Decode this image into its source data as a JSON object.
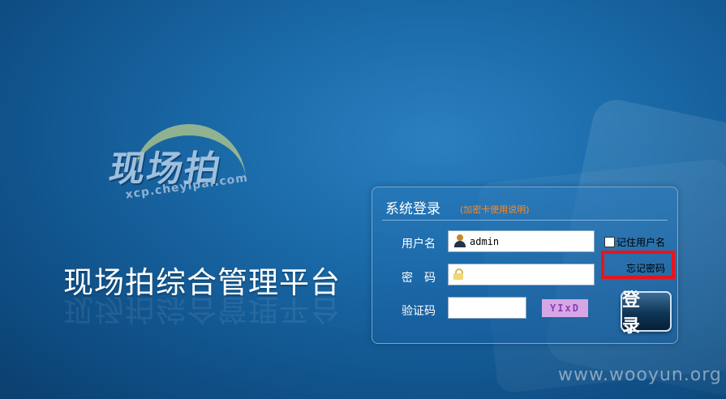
{
  "logo": {
    "brand_cn": "现场拍",
    "url": "xcp.cheyipai.com"
  },
  "platform_title": "现场拍综合管理平台",
  "login_panel": {
    "title": "系统登录",
    "help_link": "(加密卡使用说明)",
    "username_label": "用户名",
    "username_value": "admin",
    "password_label": "密　码",
    "password_value": "",
    "captcha_label": "验证码",
    "captcha_value": "",
    "captcha_image_text": "YIxD",
    "remember_label": "记住用户名",
    "forgot_link": "忘记密码",
    "login_button": "登 录"
  },
  "watermark": "www.wooyun.org",
  "colors": {
    "highlight_box": "#e8141b",
    "help_link": "#ff8a1e",
    "captcha_bg": "#d6a7e6"
  }
}
